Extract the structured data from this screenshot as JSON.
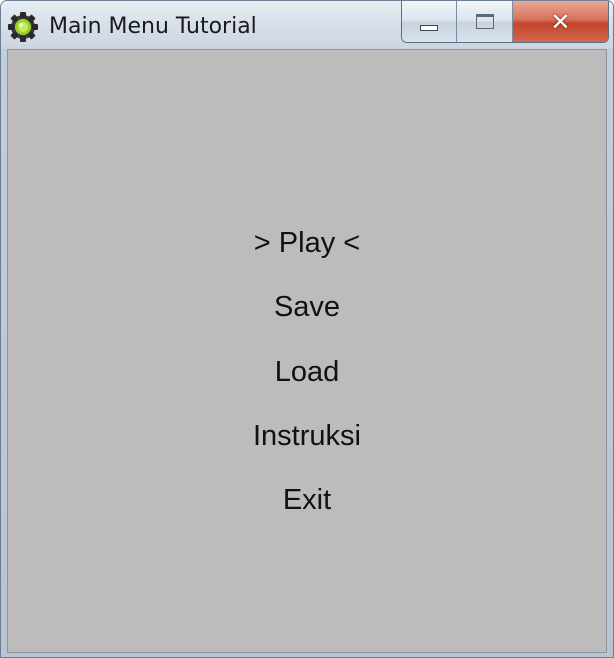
{
  "window": {
    "title": "Main Menu Tutorial",
    "icon": "gear-icon",
    "caption_buttons": {
      "minimize": "minimize-icon",
      "maximize": "maximize-icon",
      "close_glyph": "✕"
    }
  },
  "menu": {
    "items": [
      {
        "label": "> Play <",
        "selected": true
      },
      {
        "label": "Save",
        "selected": false
      },
      {
        "label": "Load",
        "selected": false
      },
      {
        "label": "Instruksi",
        "selected": false
      },
      {
        "label": "Exit",
        "selected": false
      }
    ]
  },
  "colors": {
    "client_background": "#bdbbbb",
    "text": "#111111",
    "close_button": "#c8492f"
  }
}
